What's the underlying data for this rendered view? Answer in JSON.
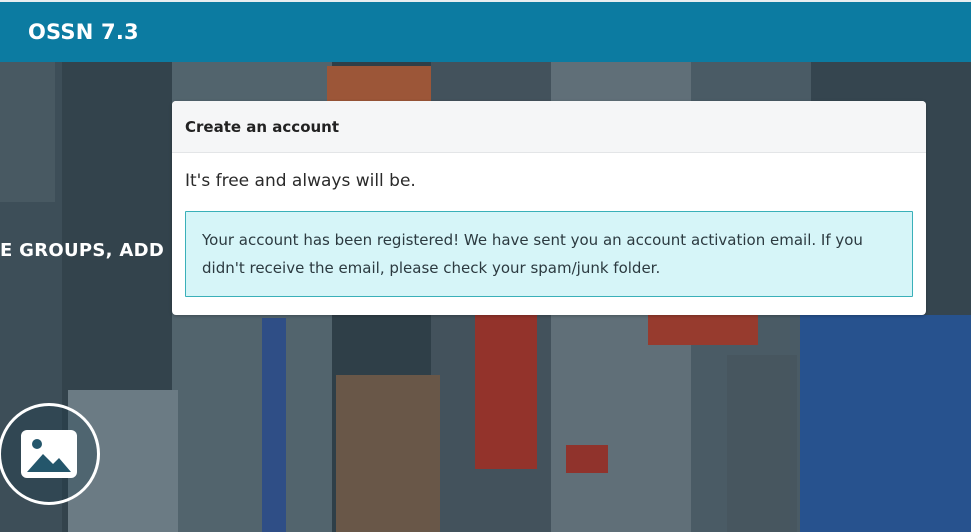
{
  "app": {
    "brand": "OSSN 7.3",
    "brand_color": "#0c7ba1"
  },
  "hero": {
    "tagline_fragment": "E GROUPS, ADD",
    "image_icon": "image-icon"
  },
  "card": {
    "title": "Create an account",
    "subtitle": "It's free and always will be.",
    "alert_message": "Your account has been registered! We have sent you an account activation email. If you didn't receive the email, please check your spam/junk folder.",
    "alert_bg": "#d6f5f8",
    "alert_border": "#3ab0b9"
  }
}
